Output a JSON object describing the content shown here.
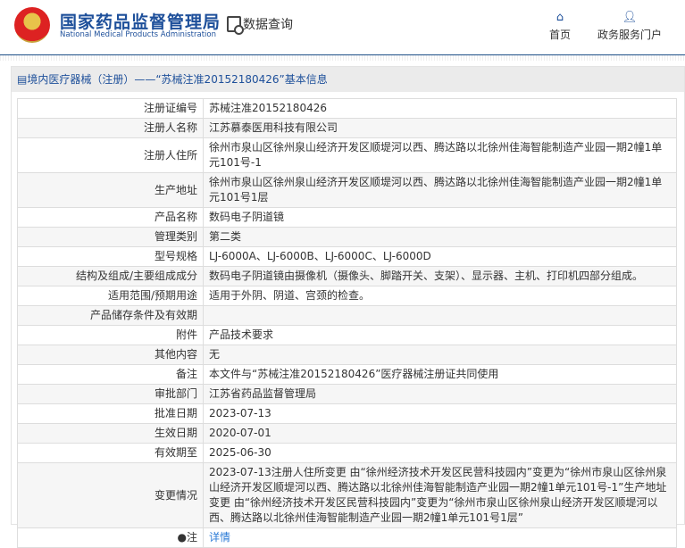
{
  "header": {
    "logo_cn": "国家药品监督管理局",
    "logo_en": "National Medical Products Administration",
    "data_query": "数据查询",
    "nav": [
      {
        "label": "首页",
        "icon": "home-icon"
      },
      {
        "label": "政务服务门户",
        "icon": "user-icon"
      }
    ]
  },
  "panel_title": "境内医疗器械（注册）——“苏械注准20152180426”基本信息",
  "rows": [
    {
      "k": "注册证编号",
      "v": "苏械注准20152180426"
    },
    {
      "k": "注册人名称",
      "v": "江苏慕泰医用科技有限公司"
    },
    {
      "k": "注册人住所",
      "v": "徐州市泉山区徐州泉山经济开发区顺堤河以西、腾达路以北徐州佳海智能制造产业园一期2幢1单元101号-1"
    },
    {
      "k": "生产地址",
      "v": "徐州市泉山区徐州泉山经济开发区顺堤河以西、腾达路以北徐州佳海智能制造产业园一期2幢1单元101号1层"
    },
    {
      "k": "产品名称",
      "v": "数码电子阴道镜"
    },
    {
      "k": "管理类别",
      "v": "第二类"
    },
    {
      "k": "型号规格",
      "v": "LJ-6000A、LJ-6000B、LJ-6000C、LJ-6000D"
    },
    {
      "k": "结构及组成/主要组成成分",
      "v": "数码电子阴道镜由摄像机（摄像头、脚踏开关、支架）、显示器、主机、打印机四部分组成。"
    },
    {
      "k": "适用范围/预期用途",
      "v": "适用于外阴、阴道、宫颈的检查。"
    },
    {
      "k": "产品储存条件及有效期",
      "v": ""
    },
    {
      "k": "附件",
      "v": "产品技术要求"
    },
    {
      "k": "其他内容",
      "v": "无"
    },
    {
      "k": "备注",
      "v": "本文件与“苏械注准20152180426”医疗器械注册证共同使用"
    },
    {
      "k": "审批部门",
      "v": "江苏省药品监督管理局"
    },
    {
      "k": "批准日期",
      "v": "2023-07-13"
    },
    {
      "k": "生效日期",
      "v": "2020-07-01"
    },
    {
      "k": "有效期至",
      "v": "2025-06-30"
    },
    {
      "k": "变更情况",
      "v": "2023-07-13注册人住所变更 由“徐州经济技术开发区民营科技园内”变更为“徐州市泉山区徐州泉山经济开发区顺堤河以西、腾达路以北徐州佳海智能制造产业园一期2幢1单元101号-1”生产地址变更 由“徐州经济技术开发区民营科技园内”变更为“徐州市泉山区徐州泉山经济开发区顺堤河以西、腾达路以北徐州佳海智能制造产业园一期2幢1单元101号1层”"
    }
  ],
  "note": {
    "label": "注",
    "link": "详情"
  }
}
